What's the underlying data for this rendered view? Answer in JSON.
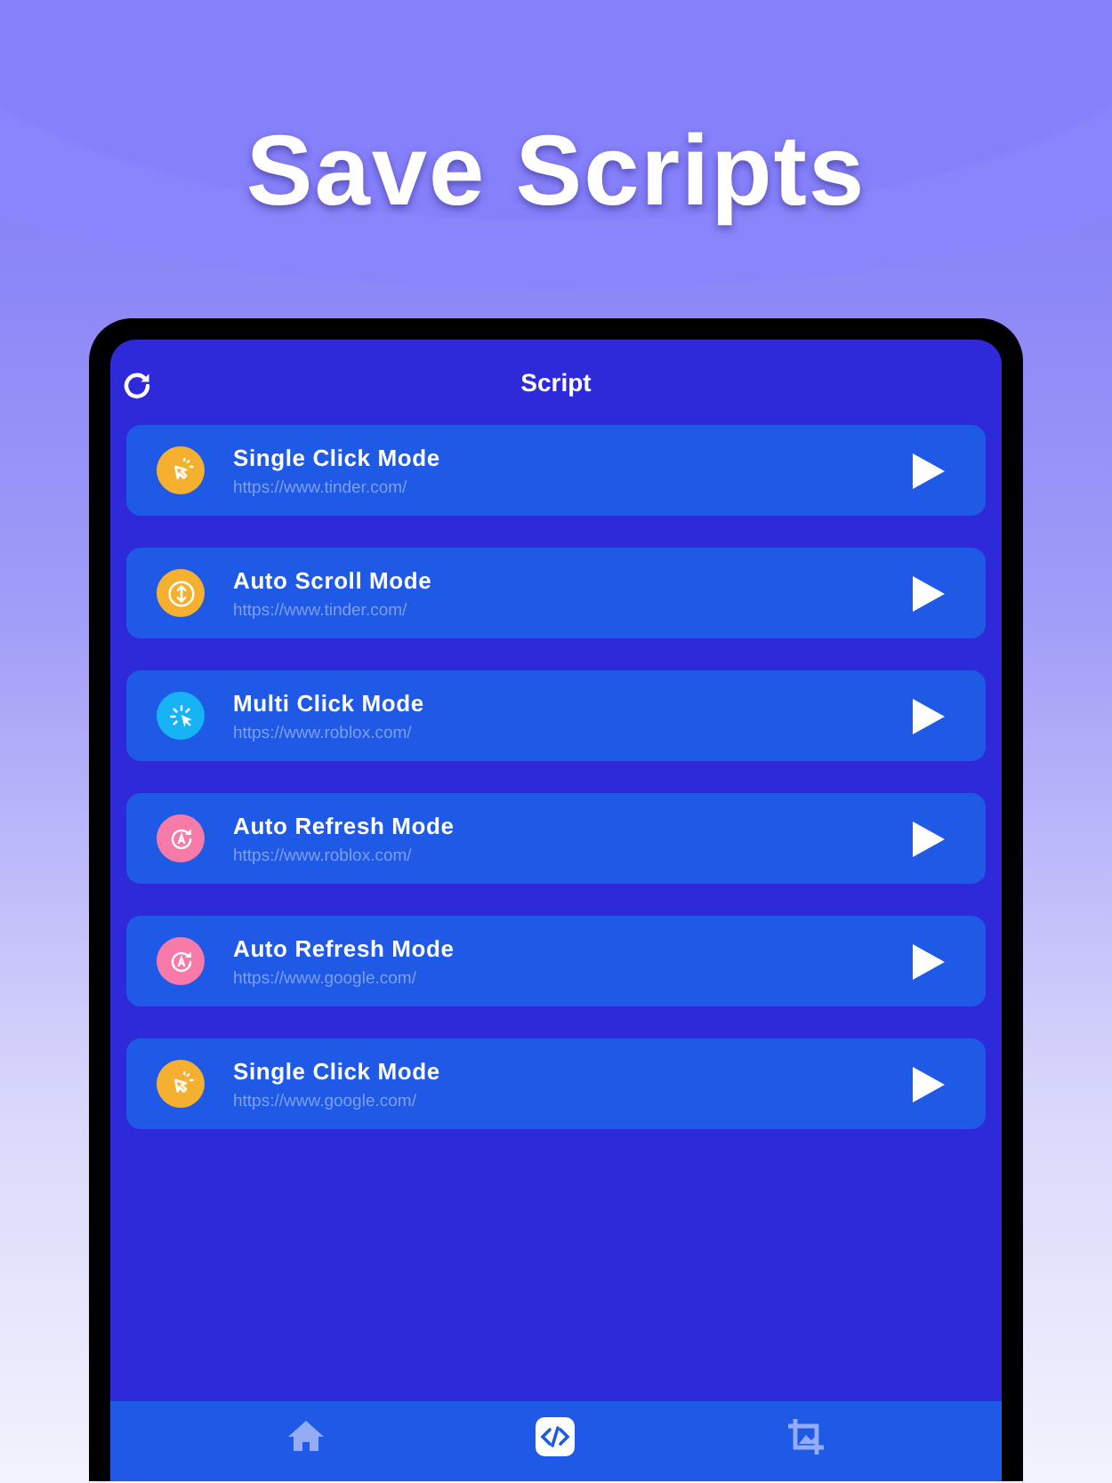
{
  "headline": "Save Scripts",
  "screen": {
    "title": "Script"
  },
  "scripts": [
    {
      "name": "Single Click Mode",
      "url": "https://www.tinder.com/",
      "kind": "single_click",
      "color": "#f5b030"
    },
    {
      "name": "Auto Scroll Mode",
      "url": "https://www.tinder.com/",
      "kind": "auto_scroll",
      "color": "#f5b030"
    },
    {
      "name": "Multi Click Mode",
      "url": "https://www.roblox.com/",
      "kind": "multi_click",
      "color": "#16b4f5"
    },
    {
      "name": "Auto Refresh Mode",
      "url": "https://www.roblox.com/",
      "kind": "auto_refresh",
      "color": "#f77aa8"
    },
    {
      "name": "Auto Refresh Mode",
      "url": "https://www.google.com/",
      "kind": "auto_refresh",
      "color": "#f77aa8"
    },
    {
      "name": "Single Click Mode",
      "url": "https://www.google.com/",
      "kind": "single_click",
      "color": "#f5b030"
    }
  ],
  "tabs": [
    {
      "kind": "home",
      "selected": false
    },
    {
      "kind": "code",
      "selected": true
    },
    {
      "kind": "crop",
      "selected": false
    }
  ]
}
